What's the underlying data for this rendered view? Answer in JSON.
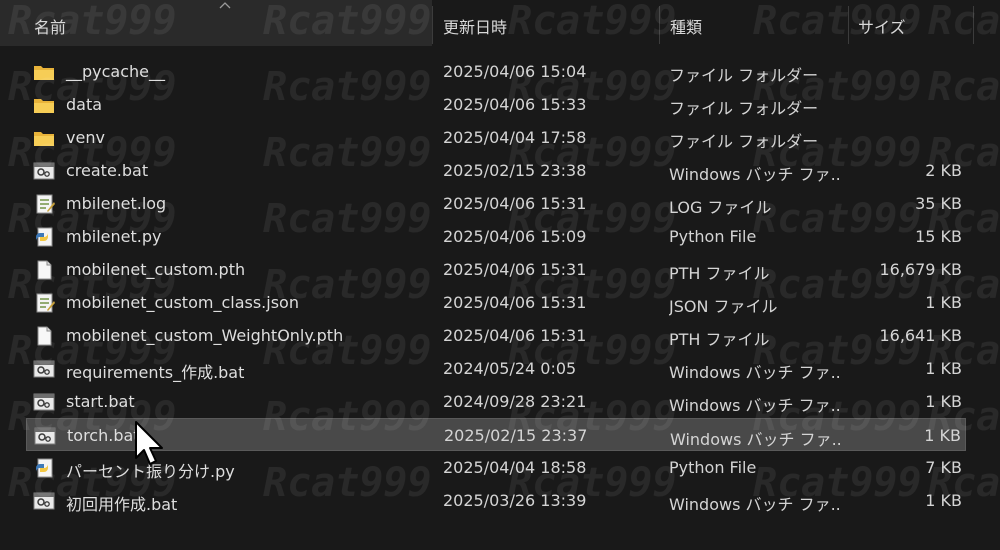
{
  "columns": {
    "name": "名前",
    "modified": "更新日時",
    "type": "種類",
    "size": "サイズ"
  },
  "watermark": "Rcat999",
  "colors": {
    "background": "#191919",
    "selected_row": "#494949",
    "folder": "#f1c24b"
  },
  "files": [
    {
      "icon": "folder-icon",
      "name": "__pycache__",
      "modified": "2025/04/06 15:04",
      "type": "ファイル フォルダー",
      "size": ""
    },
    {
      "icon": "folder-icon",
      "name": "data",
      "modified": "2025/04/06 15:33",
      "type": "ファイル フォルダー",
      "size": ""
    },
    {
      "icon": "folder-icon",
      "name": "venv",
      "modified": "2025/04/04 17:58",
      "type": "ファイル フォルダー",
      "size": ""
    },
    {
      "icon": "batch-file-icon",
      "name": "create.bat",
      "modified": "2025/02/15 23:38",
      "type": "Windows バッチ ファ...",
      "size": "2 KB"
    },
    {
      "icon": "log-file-icon",
      "name": "mbilenet.log",
      "modified": "2025/04/06 15:31",
      "type": "LOG ファイル",
      "size": "35 KB"
    },
    {
      "icon": "python-file-icon",
      "name": "mbilenet.py",
      "modified": "2025/04/06 15:09",
      "type": "Python File",
      "size": "15 KB"
    },
    {
      "icon": "blank-file-icon",
      "name": "mobilenet_custom.pth",
      "modified": "2025/04/06 15:31",
      "type": "PTH ファイル",
      "size": "16,679 KB"
    },
    {
      "icon": "log-file-icon",
      "name": "mobilenet_custom_class.json",
      "modified": "2025/04/06 15:31",
      "type": "JSON ファイル",
      "size": "1 KB"
    },
    {
      "icon": "blank-file-icon",
      "name": "mobilenet_custom_WeightOnly.pth",
      "modified": "2025/04/06 15:31",
      "type": "PTH ファイル",
      "size": "16,641 KB"
    },
    {
      "icon": "batch-file-icon",
      "name": "requirements_作成.bat",
      "modified": "2024/05/24 0:05",
      "type": "Windows バッチ ファ...",
      "size": "1 KB"
    },
    {
      "icon": "batch-file-icon",
      "name": "start.bat",
      "modified": "2024/09/28 23:21",
      "type": "Windows バッチ ファ...",
      "size": "1 KB"
    },
    {
      "icon": "batch-file-icon",
      "name": "torch.bat",
      "modified": "2025/02/15 23:37",
      "type": "Windows バッチ ファ...",
      "size": "1 KB",
      "selected": true
    },
    {
      "icon": "python-file-icon",
      "name": "パーセント振り分け.py",
      "modified": "2025/04/04 18:58",
      "type": "Python File",
      "size": "7 KB"
    },
    {
      "icon": "batch-file-icon",
      "name": "初回用作成.bat",
      "modified": "2025/03/26 13:39",
      "type": "Windows バッチ ファ...",
      "size": "1 KB"
    }
  ]
}
